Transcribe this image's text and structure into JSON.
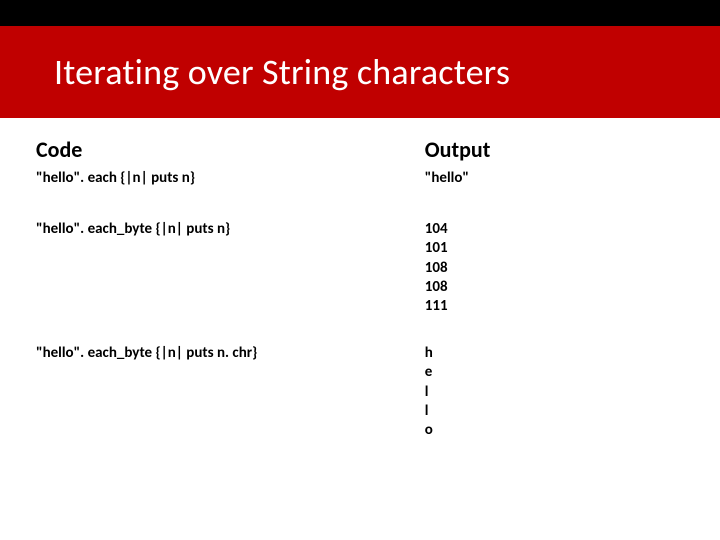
{
  "title": "Iterating over String characters",
  "table": {
    "headers": {
      "code": "Code",
      "output": "Output"
    },
    "rows": [
      {
        "code": "\"hello\". each {|n| puts n}",
        "output": "\"hello\""
      },
      {
        "code": "\"hello\". each_byte {|n| puts n}",
        "output": "104\n101\n108\n108\n111"
      },
      {
        "code": "\"hello\". each_byte {|n| puts n. chr}",
        "output": "h\ne\nl\nl\no"
      }
    ]
  }
}
